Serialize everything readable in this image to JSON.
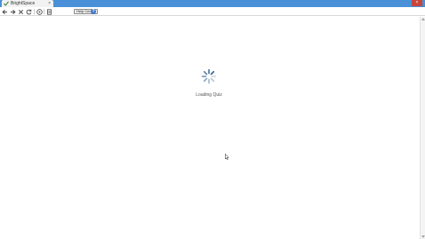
{
  "browser": {
    "tab_title": "BrightSpace",
    "tab_close_glyph": "×",
    "window_close_glyph": "×",
    "accent_color": "#4a90d9"
  },
  "toolbar": {
    "help_center_label": "Help Center",
    "help_icon_glyph": "?",
    "icons": [
      "back-arrow-icon",
      "forward-arrow-icon",
      "stop-icon",
      "refresh-icon",
      "home-icon",
      "page-icon"
    ]
  },
  "main": {
    "loading_text": "Loading Quiz",
    "spinner_color": "#2e5f8a"
  }
}
